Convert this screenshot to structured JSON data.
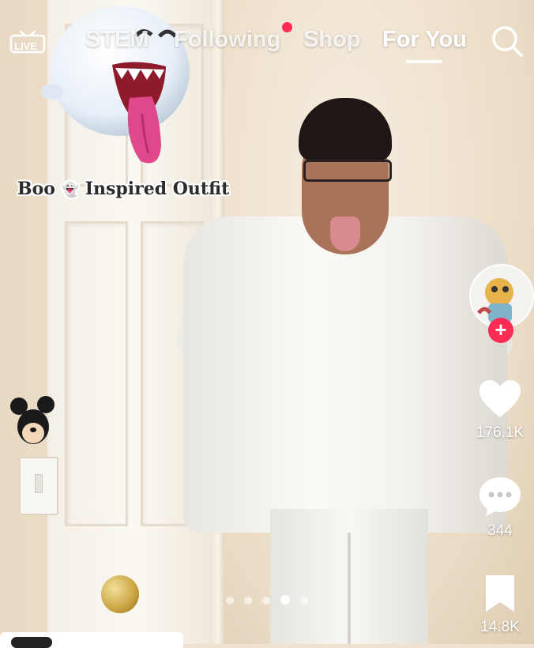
{
  "header": {
    "live_label": "LIVE",
    "tabs": [
      {
        "label": "STEM",
        "active": false
      },
      {
        "label": "Following",
        "active": false,
        "has_notification_dot": true
      },
      {
        "label": "Shop",
        "active": false
      },
      {
        "label": "For You",
        "active": true
      }
    ]
  },
  "video": {
    "caption": {
      "before": "Boo",
      "emoji": "👻",
      "after": "Inspired Outfit"
    },
    "carousel": {
      "count": 5,
      "active_index": 3
    }
  },
  "actions": {
    "likes": "176.1K",
    "comments": "344",
    "saves": "14.8K",
    "follow_symbol": "+"
  },
  "colors": {
    "accent": "#fe2c55",
    "icon": "#ffffff"
  },
  "icons": {
    "live": "live-tv-icon",
    "search": "search-icon",
    "like": "heart-icon",
    "comment": "comment-bubble-icon",
    "save": "bookmark-icon"
  }
}
